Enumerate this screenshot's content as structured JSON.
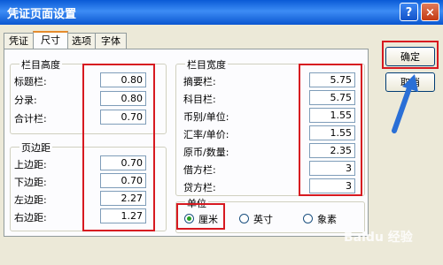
{
  "window": {
    "title": "凭证页面设置",
    "help": "?",
    "close": "×"
  },
  "tabs": [
    "凭证",
    "尺寸",
    "选项",
    "字体"
  ],
  "active_tab": 1,
  "row_height": {
    "title": "栏目高度",
    "rows": [
      {
        "label": "标题栏:",
        "value": "0.80"
      },
      {
        "label": "分录:",
        "value": "0.80"
      },
      {
        "label": "合计栏:",
        "value": "0.70"
      }
    ]
  },
  "margins": {
    "title": "页边距",
    "rows": [
      {
        "label": "上边距:",
        "value": "0.70"
      },
      {
        "label": "下边距:",
        "value": "0.70"
      },
      {
        "label": "左边距:",
        "value": "2.27"
      },
      {
        "label": "右边距:",
        "value": "1.27"
      }
    ]
  },
  "col_width": {
    "title": "栏目宽度",
    "rows": [
      {
        "label": "摘要栏:",
        "value": "5.75"
      },
      {
        "label": "科目栏:",
        "value": "5.75"
      },
      {
        "label": "币别/单位:",
        "value": "1.55"
      },
      {
        "label": "汇率/单价:",
        "value": "1.55"
      },
      {
        "label": "原币/数量:",
        "value": "2.35"
      },
      {
        "label": "借方栏:",
        "value": "3"
      },
      {
        "label": "贷方栏:",
        "value": "3"
      }
    ]
  },
  "unit": {
    "title": "单位",
    "options": [
      "厘米",
      "英寸",
      "象素"
    ],
    "selected": "厘米"
  },
  "buttons": {
    "ok": "确定",
    "cancel": "取消"
  },
  "watermark": "Baidu 经验",
  "colors": {
    "annotation_red": "#d71920",
    "arrow_blue": "#2a6fd6"
  }
}
